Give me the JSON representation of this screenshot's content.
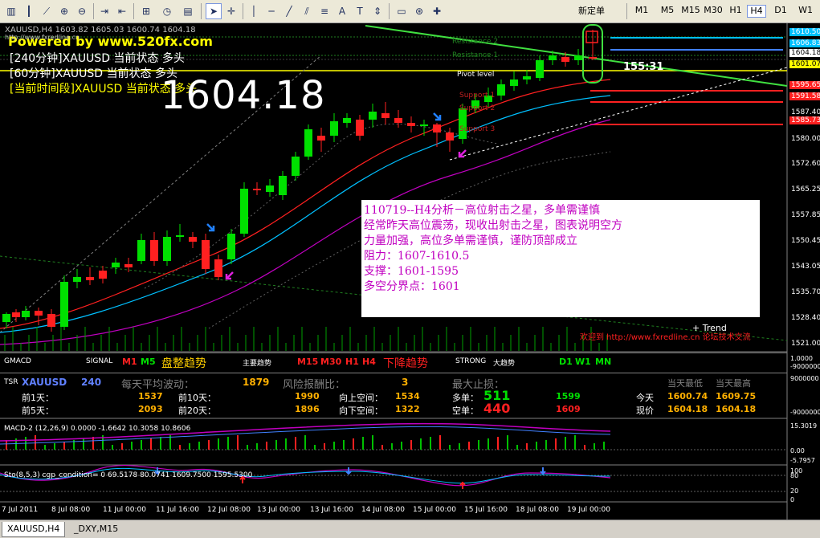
{
  "toolbar": {
    "new_order_label": "新定单",
    "timeframes": [
      "M1",
      "M5",
      "M15",
      "M30",
      "H1",
      "H4",
      "D1",
      "W1"
    ],
    "active_timeframe": "H4"
  },
  "chart": {
    "symbol_header": "XAUUSD,H4  1603.82 1605.03 1600.74 1604.18",
    "powered_by": "Powered by www.520fx.com",
    "url_small": "http://www.fxredline.cn",
    "status_240": "[240分钟]XAUUSD 当前状态 多头",
    "status_60": "[60分钟]XAUUSD 当前状态 多头",
    "status_period": "[当前时间段]XAUUSD 当前状态 多头",
    "big_price": "1604.18",
    "countdown": "155:31",
    "levels": {
      "resistance2": "Resistance 2",
      "resistance1": "Resistance 1",
      "pivot": "Pivot level",
      "support1": "Support 1",
      "support2": "Support 2",
      "support3": "Support 3"
    },
    "price_axis": [
      "1610.50",
      "1606.83",
      "1604.18",
      "1601.07",
      "1595.65",
      "1591.58",
      "1587.40",
      "1585.73",
      "1580.00",
      "1572.60",
      "1565.25",
      "1557.85",
      "1550.45",
      "1543.05",
      "1535.70",
      "1528.40",
      "1521.00"
    ],
    "analysis": {
      "line1": "110719--H4分析－高位射击之星，多单需谨慎",
      "line2": "经常昨天高位震荡，现收出射击之星，图表说明空方",
      "line3": "力量加强，高位多单需谨慎，谨防顶部成立",
      "line4": "阻力：1607-1610.5",
      "line5": "支撑：1601-1595",
      "line6": "多空分界点：1601"
    },
    "watermark": "欢迎到 http://www.fxredline.cn 论坛技术交流",
    "trend_label": "+ Trend",
    "colors": {
      "bull": "#00e000",
      "bear": "#ff2020",
      "pivot": "#ffff00",
      "resist": "#00c0ff"
    }
  },
  "gmacd": {
    "label": "GMACD",
    "signal": "SIGNAL",
    "m1": "M1",
    "m5": "M5",
    "consolidation": "盘整趋势",
    "main_trend": "主要趋势",
    "m15": "M15",
    "m30": "M30",
    "h1": "H1",
    "h4": "H4",
    "down_trend": "下降趋势",
    "strong": "STRONG",
    "big_trend": "大趋势",
    "d1": "D1",
    "w1": "W1",
    "mn": "MN",
    "axis_top": "1.0000",
    "axis_bottom": "-9000000"
  },
  "tsr": {
    "label": "TSR",
    "symbol": "XAUUSD",
    "period": "240",
    "avg_vol_label": "每天平均波动：",
    "avg_vol_value": "1879",
    "risk_label": "风险报酬比：",
    "risk_value": "3",
    "max_stop_label": "最大止损：",
    "today_low_label": "当天最低",
    "today_high_label": "当天最高",
    "prev1_label": "前1天：",
    "prev1_value": "1537",
    "prev10_label": "前10天：",
    "prev10_value": "1990",
    "up_space_label": "向上空间：",
    "up_space_value": "1534",
    "long_label": "多单：",
    "long_value": "511",
    "long_price": "1599",
    "today_label": "今天",
    "today_low": "1600.74",
    "today_high": "1609.75",
    "prev5_label": "前5天：",
    "prev5_value": "2093",
    "prev20_label": "前20天：",
    "prev20_value": "1896",
    "down_space_label": "向下空间：",
    "down_space_value": "1322",
    "short_label": "空单：",
    "short_value": "440",
    "short_price": "1609",
    "now_label": "现价",
    "now_low": "1604.18",
    "now_high": "1604.18",
    "axis_top": "9000000",
    "axis_bottom": "-9000000"
  },
  "macd": {
    "label": "MACD-2 (12,26,9) 0.0000 -1.6642 10.3058 10.8606",
    "axis_top": "15.3019",
    "axis_zero": "0.00",
    "axis_bottom": "-5.7957"
  },
  "sto": {
    "label": "Sto(8,5,3) cgp_condition= 0  69.5178 80.0741 1609.7500 1595.5300",
    "axis_top": "100",
    "axis_mid": "80",
    "axis_low": "20",
    "axis_bottom": "0"
  },
  "time_axis": [
    "7 Jul 2011",
    "8 Jul 08:00",
    "11 Jul 00:00",
    "11 Jul 16:00",
    "12 Jul 08:00",
    "13 Jul 00:00",
    "13 Jul 16:00",
    "14 Jul 08:00",
    "15 Jul 00:00",
    "15 Jul 16:00",
    "18 Jul 08:00",
    "19 Jul 00:00"
  ],
  "tabs": [
    "XAUUSD,H4",
    "_DXY,M15"
  ]
}
